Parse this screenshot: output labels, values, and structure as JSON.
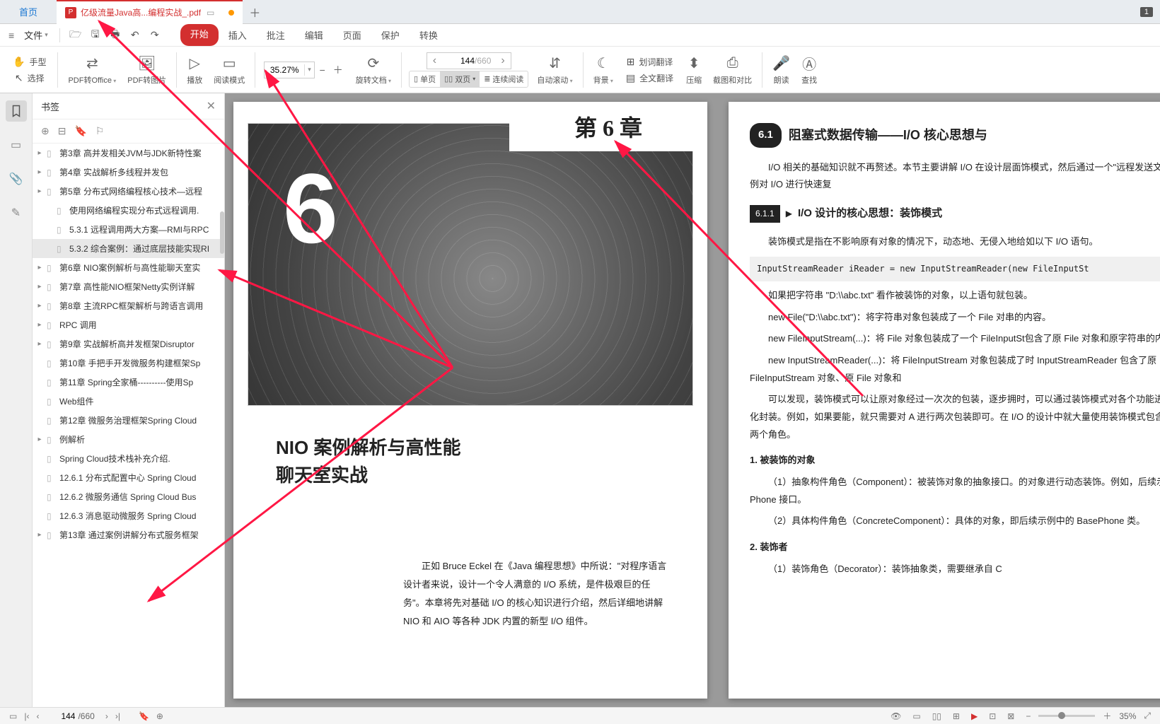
{
  "tabs": {
    "home": "首页",
    "file_name": "亿级流量Java高...编程实战_.pdf",
    "badge": "1"
  },
  "menu": {
    "file": "文件",
    "tabs": [
      "开始",
      "插入",
      "批注",
      "编辑",
      "页面",
      "保护",
      "转换"
    ]
  },
  "ribbon": {
    "hand": "手型",
    "select": "选择",
    "pdf_office": "PDF转Office",
    "pdf_image": "PDF转图片",
    "play": "播放",
    "read_mode": "阅读模式",
    "zoom": "35.27%",
    "rotate": "旋转文档",
    "page_current": "144",
    "page_total": "/660",
    "single": "单页",
    "double": "双页",
    "continuous": "连续阅读",
    "autoscroll": "自动滚动",
    "background": "背景",
    "word_translate": "划词翻译",
    "full_translate": "全文翻译",
    "compress": "压缩",
    "screenshot": "截图和对比",
    "read_aloud": "朗读",
    "find": "查找"
  },
  "bookmarks": {
    "title": "书签",
    "items": [
      {
        "level": 0,
        "expand": "▸",
        "label": "第3章 高并发相关JVM与JDK新特性案"
      },
      {
        "level": 0,
        "expand": "▸",
        "label": "第4章 实战解析多线程并发包"
      },
      {
        "level": 0,
        "expand": "▸",
        "label": "第5章 分布式网络编程核心技术—远程"
      },
      {
        "level": 1,
        "expand": "",
        "label": "使用网络编程实现分布式远程调用."
      },
      {
        "level": 1,
        "expand": "",
        "label": "5.3.1 远程调用两大方案—RMI与RPC"
      },
      {
        "level": 1,
        "expand": "",
        "label": "5.3.2 综合案例：通过底层技能实现RI",
        "sel": true
      },
      {
        "level": 0,
        "expand": "▸",
        "label": "第6章 NIO案例解析与高性能聊天室实"
      },
      {
        "level": 0,
        "expand": "▸",
        "label": "第7章 高性能NIO框架Netty实例详解"
      },
      {
        "level": 0,
        "expand": "▸",
        "label": "第8章 主流RPC框架解析与跨语言调用"
      },
      {
        "level": 0,
        "expand": "▸",
        "label": "RPC 调用"
      },
      {
        "level": 0,
        "expand": "▸",
        "label": "第9章 实战解析高并发框架Disruptor"
      },
      {
        "level": 0,
        "expand": "",
        "label": "第10章 手把手开发微服务构建框架Sp"
      },
      {
        "level": 0,
        "expand": "",
        "label": "第11章 Spring全家桶----------使用Sp"
      },
      {
        "level": 0,
        "expand": "",
        "label": "Web组件"
      },
      {
        "level": 0,
        "expand": "",
        "label": "第12章 微服务治理框架Spring Cloud"
      },
      {
        "level": 0,
        "expand": "▸",
        "label": "例解析"
      },
      {
        "level": 0,
        "expand": "",
        "label": "Spring Cloud技术栈补充介绍."
      },
      {
        "level": 0,
        "expand": "",
        "label": "12.6.1 分布式配置中心 Spring Cloud"
      },
      {
        "level": 0,
        "expand": "",
        "label": "12.6.2 微服务通信 Spring Cloud Bus"
      },
      {
        "level": 0,
        "expand": "",
        "label": "12.6.3 消息驱动微服务 Spring Cloud"
      },
      {
        "level": 0,
        "expand": "▸",
        "label": "第13章 通过案例讲解分布式服务框架"
      }
    ]
  },
  "page_left": {
    "chapter_label": "第 6 章",
    "big_num": "6",
    "title_l1": "NIO 案例解析与高性能",
    "title_l2": "聊天室实战",
    "body_p1": "正如 Bruce Eckel 在《Java 编程思想》中所说：\"对程序语言设计者来说，设计一个令人满意的 I/O 系统，是件极艰巨的任务\"。本章将先对基础 I/O 的核心知识进行介绍，然后详细地讲解 NIO 和 AIO 等各种 JDK 内置的新型 I/O 组件。"
  },
  "page_right": {
    "sec_num": "6.1",
    "sec_title": "阻塞式数据传输——I/O 核心思想与",
    "p1": "I/O 相关的基础知识就不再赘述。本节主要讲解 I/O 在设计层面饰模式，然后通过一个\"远程发送文件\"的示例对 I/O 进行快速复",
    "sub_num": "6.1.1",
    "sub_title": "I/O 设计的核心思想：装饰模式",
    "p2": "装饰模式是指在不影响原有对象的情况下，动态地、无侵入地给如以下 I/O 语句。",
    "code": "InputStreamReader iReader  = new InputStreamReader(new FileInputSt",
    "p3": "如果把字符串 \"D:\\\\abc.txt\" 看作被装饰的对象，以上语句就包装。",
    "p4": "new File(\"D:\\\\abc.txt\")：将字符串对象包装成了一个 File 对串的内容。",
    "p5": "new FileInputStream(...)：将 File 对象包装成了一个 FileInputSt包含了原 File 对象和原字符串的内容。",
    "p6": "new InputStreamReader(...)：将 FileInputStream 对象包装成了时 InputStreamReader 包含了原 FileInputStream 对象、原 File 对象和",
    "p7": "可以发现，装饰模式可以让原对象经过一次次的包装，逐步拥时，可以通过装饰模式对各个功能进行模块化封装。例如，如果要能，就只需要对 A 进行两次包装即可。在 I/O 的设计中就大量使用装饰模式包含了以下两个角色。",
    "h1": "1. 被装饰的对象",
    "p8": "（1）抽象构件角色（Component）：被装饰对象的抽象接口。的对象进行动态装饰。例如，后续示例中的 Phone 接口。",
    "p9": "（2）具体构件角色（ConcreteComponent）：具体的对象，即后续示例中的 BasePhone 类。",
    "h2": "2. 装饰者",
    "p10": "（1）装饰角色（Decorator）：装饰抽象类，需要继承自 C"
  },
  "status": {
    "page_cur": "144",
    "page_total": "/660",
    "zoom": "35%"
  }
}
